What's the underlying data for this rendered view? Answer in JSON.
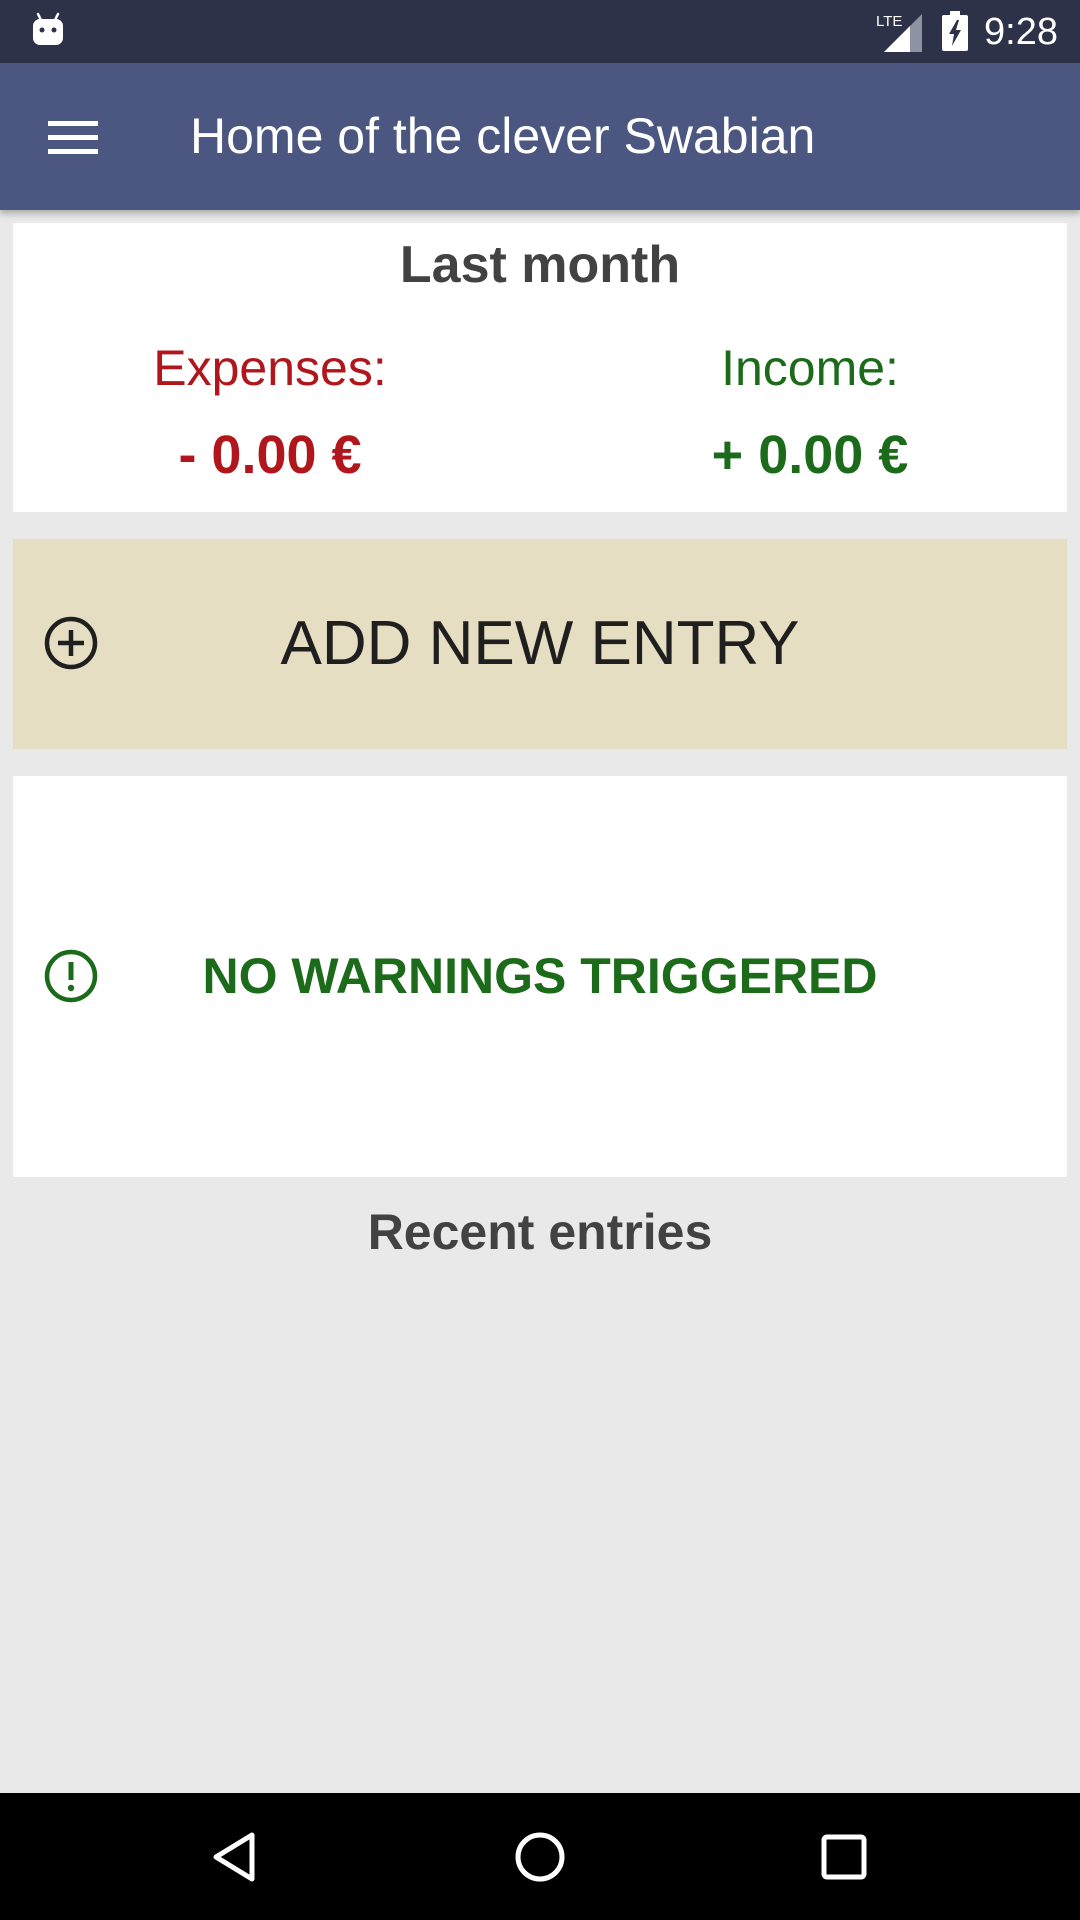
{
  "status_bar": {
    "time": "9:28",
    "network": "LTE",
    "icons": [
      "android-icon",
      "lte-signal-icon",
      "battery-charging-icon"
    ]
  },
  "app_bar": {
    "title": "Home of the clever Swabian",
    "menu_icon": "hamburger-menu-icon"
  },
  "summary": {
    "title": "Last month",
    "expenses_label": "Expenses:",
    "expenses_value": "- 0.00 €",
    "income_label": "Income:",
    "income_value": "+ 0.00 €"
  },
  "add_entry": {
    "label": "ADD NEW ENTRY",
    "icon": "add-circle-icon"
  },
  "warnings": {
    "label": "NO WARNINGS TRIGGERED",
    "icon": "alert-circle-icon"
  },
  "recent": {
    "title": "Recent entries",
    "entries": []
  },
  "nav_bar": {
    "icons": [
      "back-icon",
      "home-icon",
      "recents-icon"
    ]
  },
  "colors": {
    "status_bar": "#2d3248",
    "app_bar": "#4b5781",
    "background": "#e9e9e9",
    "expense_red": "#b0161c",
    "income_green": "#1b6b1b",
    "add_entry_bg": "#e5dec3"
  }
}
